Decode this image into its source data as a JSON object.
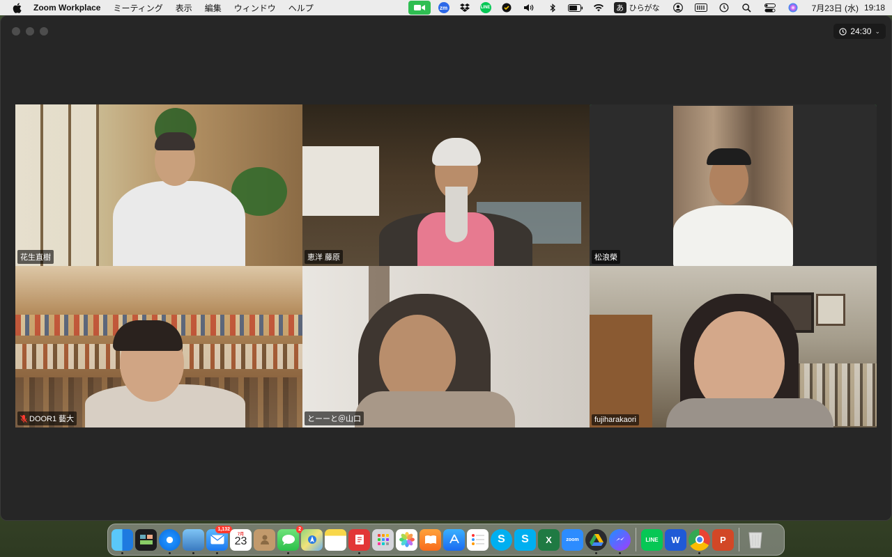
{
  "menubar": {
    "app_name": "Zoom Workplace",
    "menus": [
      "ミーティング",
      "表示",
      "編集",
      "ウィンドウ",
      "ヘルプ"
    ],
    "ime_label": "ひらがな",
    "ime_glyph": "あ",
    "zm_label": "zm",
    "line_label": "LINE",
    "date": "7月23日 (水)",
    "time": "19:18"
  },
  "window": {
    "timer": "24:30"
  },
  "participants": [
    {
      "name": "花生直樹",
      "muted": false,
      "active": false
    },
    {
      "name": "恵洋 藤原",
      "muted": false,
      "active": false
    },
    {
      "name": "松浪榮",
      "muted": false,
      "active": true
    },
    {
      "name": "DOOR1 藝大",
      "muted": true,
      "active": false
    },
    {
      "name": "とーーと＠山口",
      "muted": false,
      "active": false
    },
    {
      "name": "fujiharakaori",
      "muted": false,
      "active": false
    }
  ],
  "dock": {
    "mail_badge": "1,132",
    "messages_badge": "2",
    "calendar_month": "7月",
    "calendar_day": "23",
    "zoom_label": "zoom",
    "line_label": "LINE",
    "word_label": "W",
    "ppt_label": "P",
    "excel_label": "X",
    "skype_label": "S"
  },
  "colors": {
    "active_speaker": "#2fd84a",
    "window_bg": "#262626",
    "zoom_video_green": "#2fbe52"
  }
}
